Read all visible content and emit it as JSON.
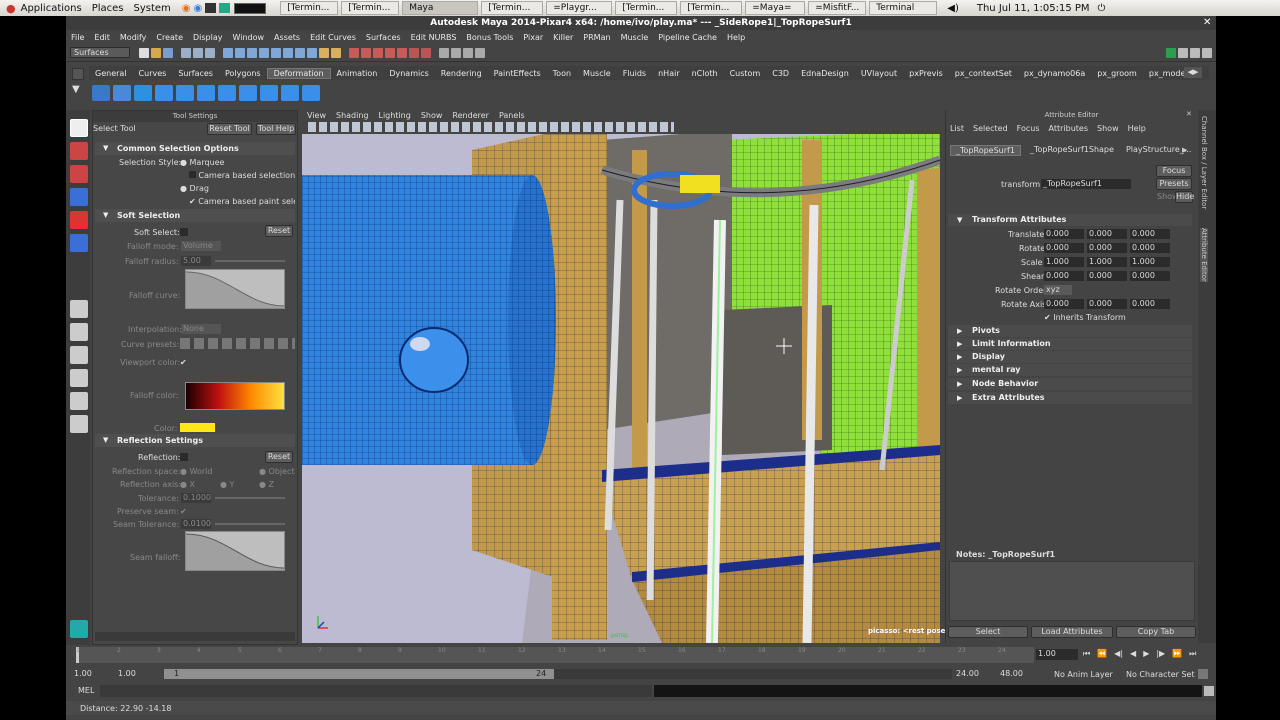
{
  "gnome_panel": {
    "applications": "Applications",
    "places": "Places",
    "system": "System",
    "tasks": [
      "[Termin...",
      "[Termin...",
      "Maya",
      "[Termin...",
      "=Playgr...",
      "[Termin...",
      "[Termin...",
      "=Maya=",
      "=MisfitF...",
      "Terminal"
    ],
    "clock": "Thu Jul 11,  1:05:15 PM"
  },
  "window_title": "Autodesk Maya 2014-Pixar4 x64: /home/ivo/play.ma*  ---  _SideRope1|_TopRopeSurf1",
  "menubar": [
    "File",
    "Edit",
    "Modify",
    "Create",
    "Display",
    "Window",
    "Assets",
    "Edit Curves",
    "Surfaces",
    "Edit NURBS",
    "Bonus Tools",
    "Pixar",
    "Killer",
    "PRMan",
    "Muscle",
    "Pipeline Cache",
    "Help"
  ],
  "statusline": {
    "menuset": "Surfaces"
  },
  "shelf_tabs": [
    "General",
    "Curves",
    "Surfaces",
    "Polygons",
    "Deformation",
    "Animation",
    "Dynamics",
    "Rendering",
    "PaintEffects",
    "Toon",
    "Muscle",
    "Fluids",
    "nHair",
    "nCloth",
    "Custom",
    "C3D",
    "EdnaDesign",
    "UVlayout",
    "pxPrevis",
    "px_contextSet",
    "px_dynamo06a",
    "px_groom",
    "px_modeling"
  ],
  "shelf_active": "Deformation",
  "tool_settings": {
    "title": "Tool Settings",
    "tool_name": "Select Tool",
    "reset_tool": "Reset Tool",
    "tool_help": "Tool Help",
    "common_header": "Common Selection Options",
    "selection_style": "Selection Style:",
    "marquee": "Marquee",
    "camera_based_selection": "Camera based selection",
    "drag": "Drag",
    "camera_based_paint": "Camera based paint selection",
    "soft_header": "Soft Selection",
    "soft_select": "Soft Select:",
    "reset": "Reset",
    "falloff_mode": "Falloff mode:",
    "falloff_mode_value": "Volume",
    "falloff_radius": "Falloff radius:",
    "falloff_radius_value": "5.00",
    "falloff_curve": "Falloff curve:",
    "interpolation": "Interpolation:",
    "interpolation_value": "None",
    "curve_presets": "Curve presets:",
    "viewport_color": "Viewport color:",
    "falloff_color": "Falloff color:",
    "color": "Color:",
    "reflection_header": "Reflection Settings",
    "reflection": "Reflection:",
    "reflection_space": "Reflection space:",
    "world": "World",
    "object": "Object",
    "reflection_axis": "Reflection axis:",
    "axis_x": "X",
    "axis_y": "Y",
    "axis_z": "Z",
    "tolerance": "Tolerance:",
    "tolerance_value": "0.1000",
    "preserve_seam": "Preserve seam:",
    "seam_tolerance": "Seam Tolerance:",
    "seam_tolerance_value": "0.0100",
    "seam_falloff": "Seam falloff:"
  },
  "viewport": {
    "menus": [
      "View",
      "Shading",
      "Lighting",
      "Show",
      "Renderer",
      "Panels"
    ],
    "camera_label": "picasso: <rest pose>",
    "corner_label": "persp"
  },
  "attribute_editor": {
    "title": "Attribute Editor",
    "menus": [
      "List",
      "Selected",
      "Focus",
      "Attributes",
      "Show",
      "Help"
    ],
    "tabs": [
      "_TopRopeSurf1",
      "_TopRopeSurf1Shape",
      "PlayStructure_..."
    ],
    "transform_label": "transform:",
    "transform_value": "_TopRopeSurf1",
    "focus": "Focus",
    "presets": "Presets",
    "show": "Show",
    "hide": "Hide",
    "transform_attributes": "Transform Attributes",
    "translate": "Translate",
    "rotate": "Rotate",
    "scale": "Scale",
    "shear": "Shear",
    "rotate_order": "Rotate Order",
    "rotate_order_value": "xyz",
    "rotate_axis": "Rotate Axis",
    "translate_values": [
      "0.000",
      "0.000",
      "0.000"
    ],
    "rotate_values": [
      "0.000",
      "0.000",
      "0.000"
    ],
    "scale_values": [
      "1.000",
      "1.000",
      "1.000"
    ],
    "shear_values": [
      "0.000",
      "0.000",
      "0.000"
    ],
    "rotate_axis_values": [
      "0.000",
      "0.000",
      "0.000"
    ],
    "inherits_transform": "Inherits Transform",
    "sections": [
      "Pivots",
      "Limit Information",
      "Display",
      "mental ray",
      "Node Behavior",
      "Extra Attributes"
    ],
    "notes": "Notes:  _TopRopeSurf1",
    "select": "Select",
    "load_attributes": "Load Attributes",
    "copy_tab": "Copy Tab"
  },
  "sidebar_tabs": [
    "Channel Box / Layer Editor",
    "Attribute Editor"
  ],
  "time_slider": {
    "ticks": [
      "1",
      "2",
      "3",
      "4",
      "5",
      "6",
      "7",
      "8",
      "9",
      "10",
      "11",
      "12",
      "13",
      "14",
      "15",
      "16",
      "17",
      "18",
      "19",
      "20",
      "21",
      "22",
      "23",
      "24"
    ],
    "current_frame": "1.00"
  },
  "range_slider": {
    "start": "1.00",
    "inner_start": "1.00",
    "range_start_label": "1",
    "range_end_label": "24",
    "end": "24.00",
    "outer_end": "48.00",
    "anim_layer": "No Anim Layer",
    "char_set": "No Character Set"
  },
  "command_line": {
    "label": "MEL"
  },
  "help_line": {
    "text": "Distance:   22.90    -14.18"
  }
}
